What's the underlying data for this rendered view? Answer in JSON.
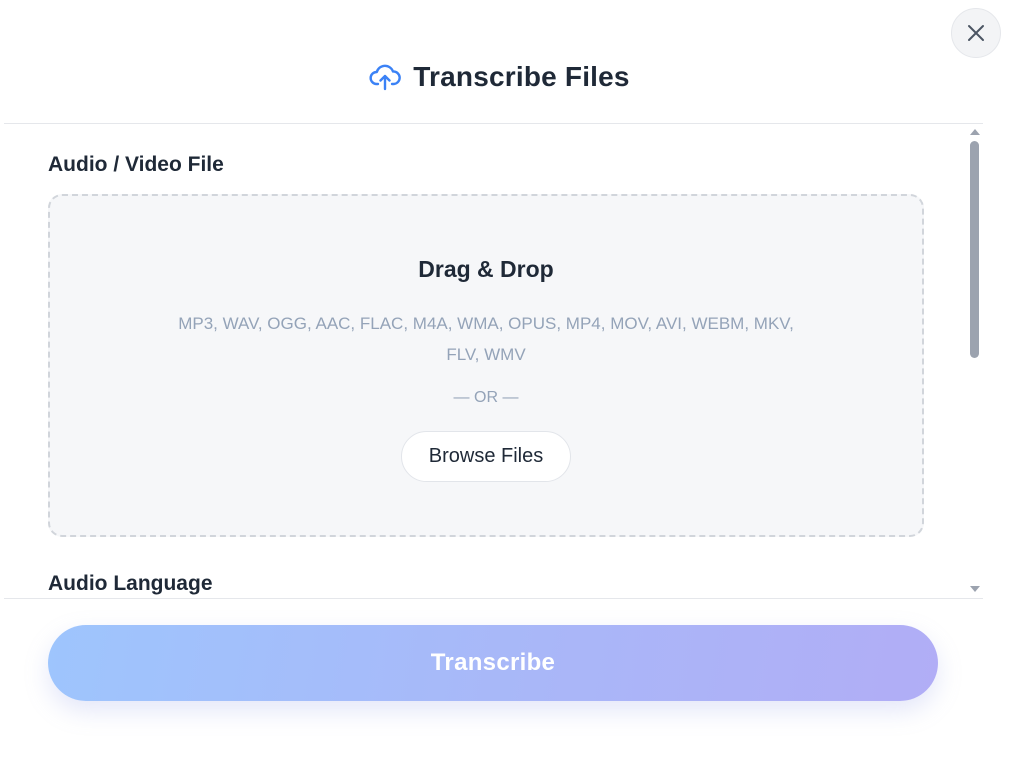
{
  "dialog": {
    "title": "Transcribe Files",
    "title_icon": "cloud-upload-icon",
    "close_icon": "close-icon"
  },
  "file_section": {
    "label": "Audio / Video File",
    "dropzone": {
      "title": "Drag & Drop",
      "formats": "MP3, WAV, OGG, AAC, FLAC, M4A, WMA, OPUS, MP4, MOV, AVI, WEBM, MKV, FLV, WMV",
      "separator": "— OR —",
      "browse_label": "Browse Files"
    }
  },
  "language_section": {
    "label": "Audio Language"
  },
  "footer": {
    "transcribe_label": "Transcribe"
  },
  "colors": {
    "accent_icon": "#3b82f6",
    "button_gradient_start": "#9ec5fd",
    "button_gradient_end": "#b1adf6",
    "muted_text": "#94a3b8"
  }
}
